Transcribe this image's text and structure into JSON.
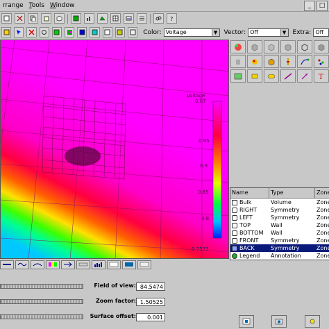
{
  "menu": {
    "items": [
      {
        "text": "rrange",
        "underline": ""
      },
      {
        "text": "Tools",
        "underline": "T"
      },
      {
        "text": "Window",
        "underline": "W"
      }
    ]
  },
  "toolbar": {
    "color_label": "Color:",
    "color_value": "Voltage",
    "vector_label": "Vector:",
    "vector_value": "Off",
    "extra_label": "Extra:",
    "extra_value": "Off"
  },
  "legend": {
    "title": "Voltage",
    "ticks": [
      "0.07",
      "0.95",
      "0.9",
      "0.85",
      "0.8",
      "0.7573"
    ]
  },
  "object_table": {
    "columns": [
      "Name",
      "Type",
      "Zone"
    ],
    "rows": [
      {
        "name": "Bulk",
        "type": "Volume",
        "zone": "Zone",
        "icon": "grid-icon",
        "selected": false
      },
      {
        "name": "RIGHT",
        "type": "Symmetry",
        "zone": "Zone",
        "icon": "pentagon-icon",
        "selected": false
      },
      {
        "name": "LEFT",
        "type": "Symmetry",
        "zone": "Zone",
        "icon": "pentagon-icon",
        "selected": false
      },
      {
        "name": "TOP",
        "type": "Wall",
        "zone": "Zone",
        "icon": "pentagon-icon",
        "selected": false
      },
      {
        "name": "BOTTOM",
        "type": "Wall",
        "zone": "Zone",
        "icon": "pentagon-icon",
        "selected": false
      },
      {
        "name": "FRONT",
        "type": "Symmetry",
        "zone": "Zone",
        "icon": "pentagon-icon",
        "selected": false
      },
      {
        "name": "BACK",
        "type": "Symmetry",
        "zone": "Zone",
        "icon": "pentagon-icon",
        "selected": true
      },
      {
        "name": "Legend",
        "type": "Annotation",
        "zone": "Zone",
        "icon": "globe-icon",
        "selected": false
      }
    ]
  },
  "view_controls": {
    "field_of_view_label": "Field of view:",
    "field_of_view_value": "84.5474",
    "zoom_factor_label": "Zoom factor:",
    "zoom_factor_value": "1.50525",
    "surface_offset_label": "Surface offset:",
    "surface_offset_value": "0.001"
  },
  "colors": {
    "accent_selected": "#0a1a7a",
    "field_high": "#ff00ff",
    "field_low": "#ff0000"
  }
}
